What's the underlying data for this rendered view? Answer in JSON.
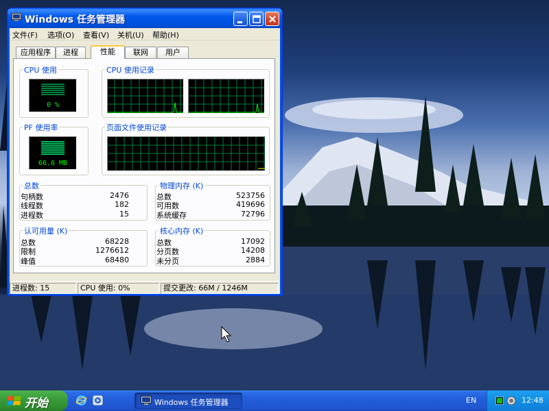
{
  "window": {
    "title": "Windows 任务管理器"
  },
  "menu": {
    "items": [
      "文件(F)",
      "选项(O)",
      "查看(V)",
      "关机(U)",
      "帮助(H)"
    ]
  },
  "tabs": [
    "应用程序",
    "进程",
    "性能",
    "联网",
    "用户"
  ],
  "active_tab": "性能",
  "perf": {
    "cpu_usage_label": "CPU 使用",
    "cpu_usage_value": "0 %",
    "cpu_history_label": "CPU 使用记录",
    "pf_usage_label": "PF 使用率",
    "pf_usage_value": "66.6 MB",
    "pf_history_label": "页面文件使用记录"
  },
  "totals": {
    "label": "总数",
    "rows": [
      {
        "k": "句柄数",
        "v": "2476"
      },
      {
        "k": "线程数",
        "v": "182"
      },
      {
        "k": "进程数",
        "v": "15"
      }
    ]
  },
  "physical_memory": {
    "label": "物理内存 (K)",
    "rows": [
      {
        "k": "总数",
        "v": "523756"
      },
      {
        "k": "可用数",
        "v": "419696"
      },
      {
        "k": "系统缓存",
        "v": "72796"
      }
    ]
  },
  "commit_charge": {
    "label": "认可用量 (K)",
    "rows": [
      {
        "k": "总数",
        "v": "68228"
      },
      {
        "k": "限制",
        "v": "1276612"
      },
      {
        "k": "峰值",
        "v": "68480"
      }
    ]
  },
  "kernel_memory": {
    "label": "核心内存 (K)",
    "rows": [
      {
        "k": "总数",
        "v": "17092"
      },
      {
        "k": "分页数",
        "v": "14208"
      },
      {
        "k": "未分页",
        "v": "2884"
      }
    ]
  },
  "status": {
    "processes": "进程数: 15",
    "cpu": "CPU 使用: 0%",
    "commit": "提交更改: 66M / 1246M"
  },
  "taskbar": {
    "start_label": "开始",
    "task_label": "Windows 任务管理器",
    "language": "EN",
    "clock": "12:48"
  },
  "colors": {
    "graph_grid": "#008040",
    "graph_line": "#00ff00",
    "pf_line": "#ffff00",
    "label_blue": "#0046d5"
  },
  "icons": [
    "task-manager-icon",
    "minimize-icon",
    "maximize-icon",
    "close-icon",
    "windows-logo-icon",
    "ie-icon",
    "media-player-icon",
    "tray-icon",
    "volume-icon",
    "mouse-cursor-icon"
  ]
}
